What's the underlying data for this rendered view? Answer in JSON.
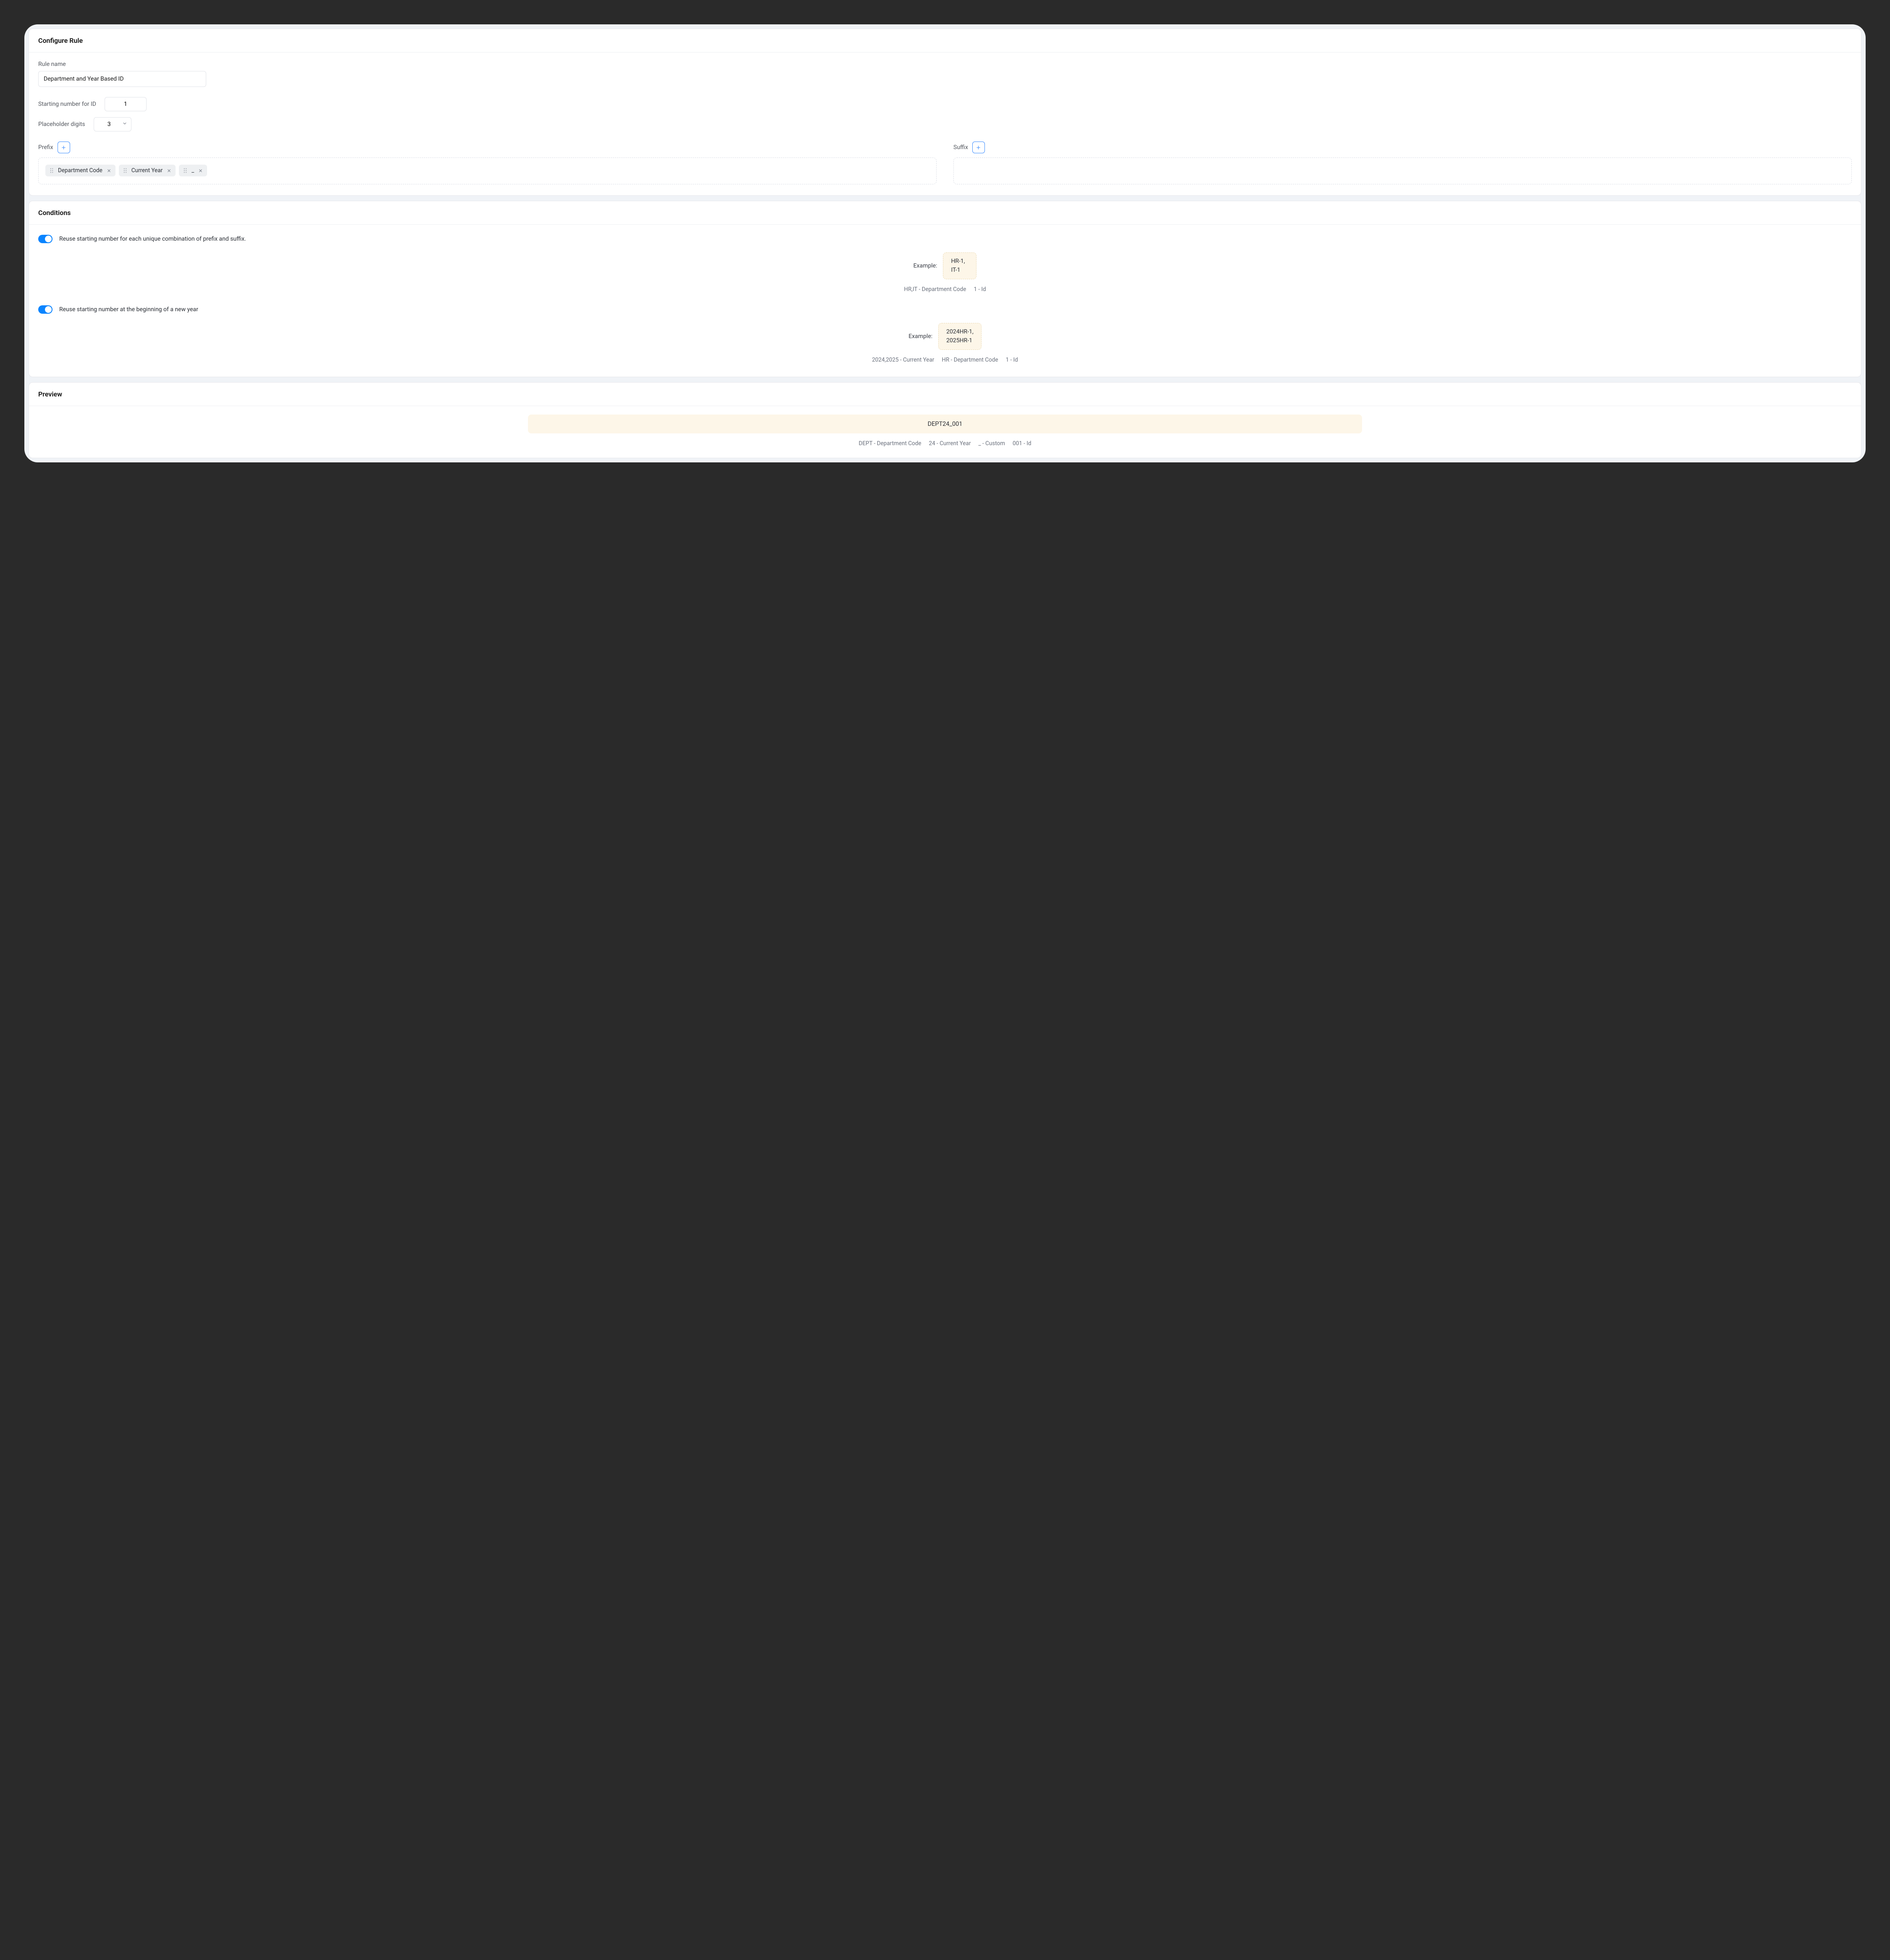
{
  "configure": {
    "title": "Configure Rule",
    "rule_name_label": "Rule name",
    "rule_name_value": "Department and Year Based ID",
    "starting_number_label": "Starting number for ID",
    "starting_number_value": "1",
    "placeholder_digits_label": "Placeholder digits",
    "placeholder_digits_value": "3",
    "prefix_label": "Prefix",
    "suffix_label": "Suffix",
    "prefix_tokens": [
      "Department Code",
      "Current Year",
      "_"
    ],
    "suffix_tokens": []
  },
  "conditions": {
    "title": "Conditions",
    "example_label": "Example:",
    "reuse_combo": {
      "label": "Reuse starting number for each unique combination of prefix and suffix.",
      "example_lines": [
        "HR-1,",
        "IT-1"
      ],
      "legend": [
        "HR,IT - Department Code",
        "1 - Id"
      ]
    },
    "reuse_year": {
      "label": "Reuse starting number at the beginning of a new year",
      "example_lines": [
        "2024HR-1,",
        "2025HR-1"
      ],
      "legend": [
        "2024,2025 - Current Year",
        "HR - Department Code",
        "1 - Id"
      ]
    }
  },
  "preview": {
    "title": "Preview",
    "value": "DEPT24_001",
    "legend": [
      "DEPT - Department Code",
      "24 - Current Year",
      "_ - Custom",
      "001 - Id"
    ]
  }
}
